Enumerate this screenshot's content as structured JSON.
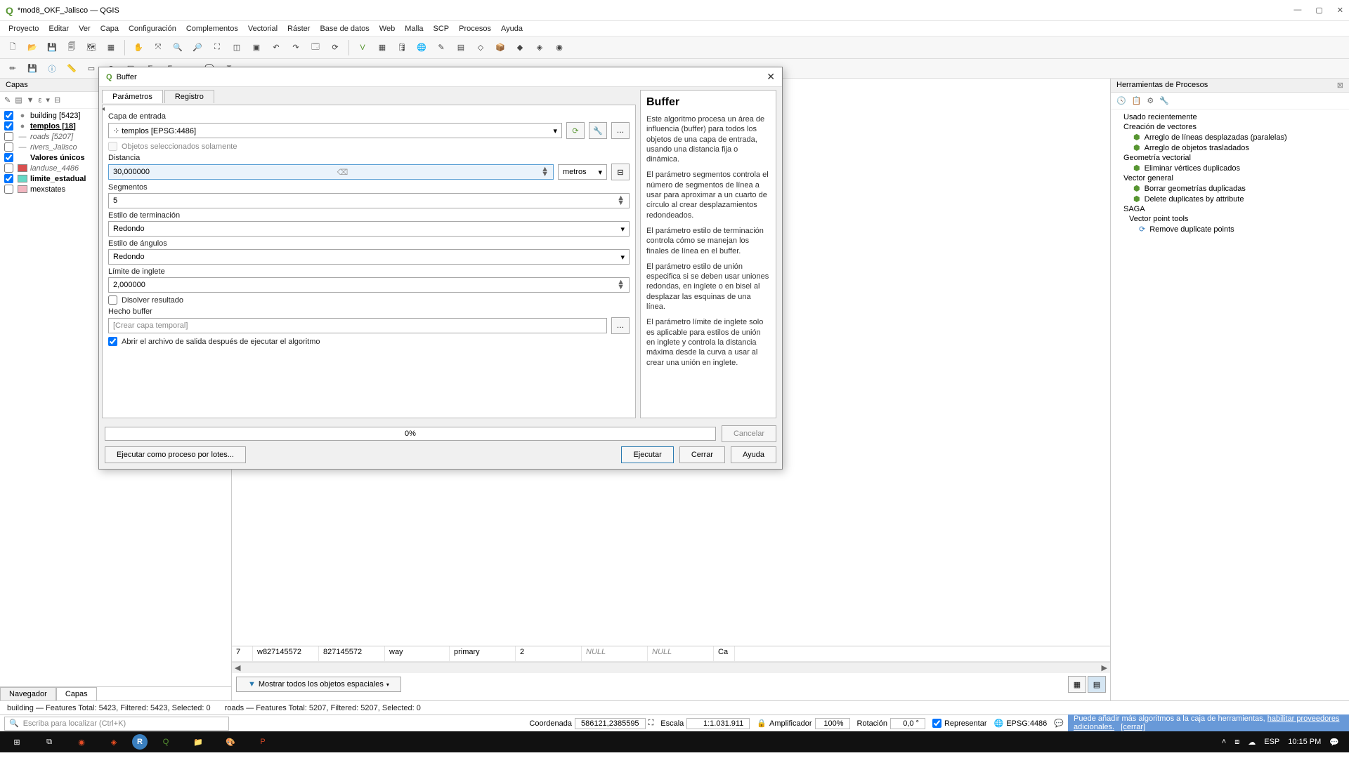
{
  "window": {
    "title": "*mod8_OKF_Jalisco — QGIS"
  },
  "menubar": [
    "Proyecto",
    "Editar",
    "Ver",
    "Capa",
    "Configuración",
    "Complementos",
    "Vectorial",
    "Ráster",
    "Base de datos",
    "Web",
    "Malla",
    "SCP",
    "Procesos",
    "Ayuda"
  ],
  "layersPanel": {
    "title": "Capas",
    "items": [
      {
        "checked": true,
        "swatch": "#808080",
        "shape": "point",
        "label": "building [5423]"
      },
      {
        "checked": true,
        "swatch": "#808080",
        "shape": "point",
        "label": "templos [18]",
        "bold": true,
        "underline": true
      },
      {
        "checked": false,
        "swatch": "#808080",
        "shape": "line",
        "label": "roads [5207]",
        "italic": true
      },
      {
        "checked": false,
        "swatch": "#808080",
        "shape": "line",
        "label": "rivers_Jalisco",
        "italic": true
      },
      {
        "checked": true,
        "swatch": "",
        "shape": "none",
        "label": "Valores únicos",
        "bold": true
      },
      {
        "checked": false,
        "swatch": "#d94f4f",
        "shape": "poly",
        "label": "landuse_4486",
        "italic": true
      },
      {
        "checked": true,
        "swatch": "#66d9c6",
        "shape": "poly",
        "label": "limite_estadual",
        "bold": true
      },
      {
        "checked": false,
        "swatch": "#f2b6c0",
        "shape": "poly",
        "label": "mexstates"
      }
    ],
    "tabs": [
      "Navegador",
      "Capas"
    ],
    "activeTab": 1
  },
  "rightPanel": {
    "title": "Herramientas de Procesos",
    "items": [
      "Usado recientemente",
      "Creación de vectores",
      "Arreglo de líneas desplazadas (paralelas)",
      "Arreglo de objetos trasladados",
      "Geometría vectorial",
      "Eliminar vértices duplicados",
      "Vector general",
      "Borrar geometrías duplicadas",
      "Delete duplicates by attribute",
      "SAGA",
      "Vector point tools",
      "Remove duplicate points"
    ]
  },
  "dialog": {
    "title": "Buffer",
    "tabs": [
      "Parámetros",
      "Registro"
    ],
    "activeTab": 0,
    "labels": {
      "inputLayer": "Capa de entrada",
      "selectedOnly": "Objetos seleccionados solamente",
      "distance": "Distancia",
      "segments": "Segmentos",
      "endcap": "Estilo de terminación",
      "joinstyle": "Estilo de ángulos",
      "miter": "Límite de inglete",
      "dissolve": "Disolver resultado",
      "output": "Hecho buffer",
      "openOutput": "Abrir el archivo de salida después de ejecutar el algoritmo"
    },
    "values": {
      "inputLayer": "templos [EPSG:4486]",
      "distance": "30,000000",
      "distanceUnit": "metros",
      "segments": "5",
      "endcap": "Redondo",
      "joinstyle": "Redondo",
      "miter": "2,000000",
      "outputPlaceholder": "[Crear capa temporal]",
      "dissolveChecked": false,
      "openOutputChecked": true
    },
    "help": {
      "title": "Buffer",
      "p1": "Este algoritmo procesa un área de influencia (buffer) para todos los objetos de una capa de entrada, usando una distancia fija o dinámica.",
      "p2": "El parámetro segmentos controla el número de segmentos de línea a usar para aproximar a un cuarto de círculo al crear desplazamientos redondeados.",
      "p3": "El parámetro estilo de terminación controla cómo se manejan los finales de línea en el buffer.",
      "p4": "El parámetro estilo de unión especifica si se deben usar uniones redondas, en inglete o en bisel al desplazar las esquinas de una línea.",
      "p5": "El parámetro límite de inglete solo es aplicable para estilos de unión en inglete y controla la distancia máxima desde la curva a usar al crear una unión en inglete."
    },
    "progress": "0%",
    "buttons": {
      "batch": "Ejecutar como proceso por lotes...",
      "run": "Ejecutar",
      "close": "Cerrar",
      "help": "Ayuda",
      "cancel": "Cancelar"
    }
  },
  "tableRow": {
    "cells": [
      "7",
      "w827145572",
      "827145572",
      "way",
      "primary",
      "2",
      "NULL",
      "NULL",
      "Ca"
    ],
    "filterText": "Mostrar todos los objetos espaciales"
  },
  "status1": {
    "left": "building — Features Total: 5423, Filtered: 5423, Selected: 0",
    "right": "roads — Features Total: 5207, Filtered: 5207, Selected: 0"
  },
  "tip": {
    "text": "Puede añadir más algoritmos a la caja de herramientas,",
    "link1": "habilitar proveedores adicionales.",
    "link2": "[cerrar]"
  },
  "bottom": {
    "searchPlaceholder": "Escriba para localizar (Ctrl+K)",
    "coordLabel": "Coordenada",
    "coordVal": "586121,2385595",
    "scaleLabel": "Escala",
    "scaleVal": "1:1.031.911",
    "ampLabel": "Amplificador",
    "ampVal": "100%",
    "rotLabel": "Rotación",
    "rotVal": "0,0 °",
    "renderLabel": "Representar",
    "crs": "EPSG:4486"
  },
  "taskbar": {
    "lang": "ESP",
    "time": "10:15 PM"
  }
}
